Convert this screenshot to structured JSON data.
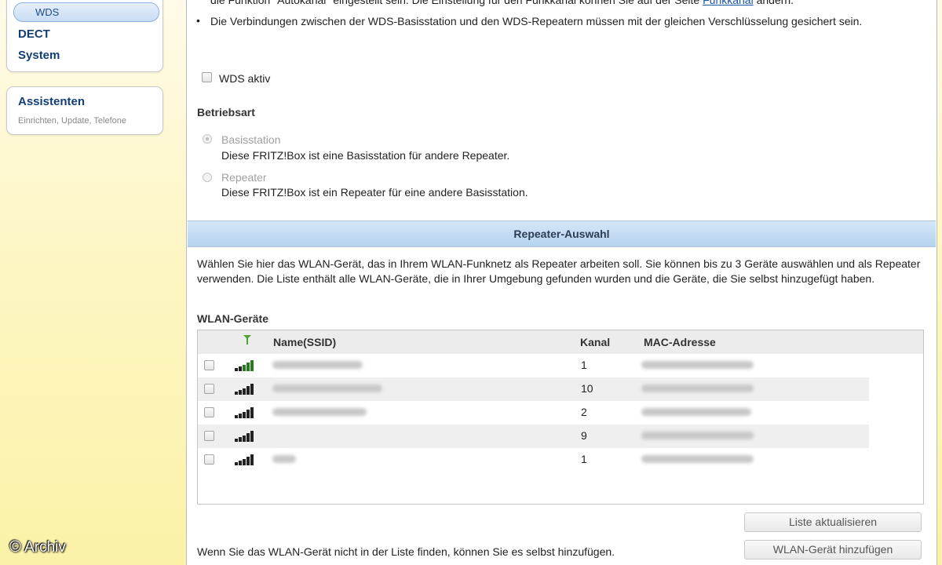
{
  "sidebar": {
    "active_item": "WDS",
    "items": [
      "DECT",
      "System"
    ],
    "assistants_title": "Assistenten",
    "assistants_subtitle": "Einrichten, Update, Telefone"
  },
  "watermark": {
    "symbol": "©",
    "text": "Archiv"
  },
  "intro": {
    "partial_line_before_link": "die Funktion \"Autokanal\" eingestellt sein. Die Einstellung für den Funkkanal können Sie auf der Seite",
    "link_text": "Funkkanal",
    "partial_line_after_link": "ändern.",
    "bullet": "Die Verbindungen zwischen der WDS-Basisstation und den WDS-Repeatern müssen mit der gleichen Verschlüsselung gesichert sein."
  },
  "wds_active_label": "WDS aktiv",
  "betriebsart": {
    "title": "Betriebsart",
    "options": [
      {
        "label": "Basisstation",
        "description": "Diese FRITZ!Box ist eine Basisstation für andere Repeater.",
        "checked": true
      },
      {
        "label": "Repeater",
        "description": "Diese FRITZ!Box ist ein Repeater für eine andere Basisstation.",
        "checked": false
      }
    ]
  },
  "repeater_section": {
    "title": "Repeater-Auswahl",
    "description": "Wählen Sie hier das WLAN-Gerät, das in Ihrem WLAN-Funknetz als Repeater arbeiten soll. Sie können bis zu 3 Geräte auswählen und als Repeater verwenden. Die Liste enthält alle WLAN-Geräte, die in Ihrer Umgebung gefunden wurden und die Geräte, die Sie selbst hinzugefügt haben.",
    "devices_title": "WLAN-Geräte",
    "columns": {
      "signal": "signal-icon",
      "name": "Name(SSID)",
      "channel": "Kanal",
      "mac": "MAC-Adresse"
    },
    "rows": [
      {
        "channel": "1"
      },
      {
        "channel": "10"
      },
      {
        "channel": "2"
      },
      {
        "channel": "9"
      },
      {
        "channel": "1"
      }
    ],
    "refresh_button": "Liste aktualisieren",
    "add_hint": "Wenn Sie das WLAN-Gerät nicht in der Liste finden, können Sie es selbst hinzufügen.",
    "add_button": "WLAN-Gerät hinzufügen"
  }
}
